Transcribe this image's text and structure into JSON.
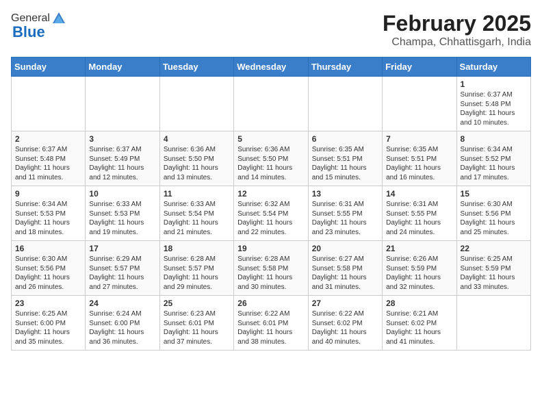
{
  "header": {
    "logo_general": "General",
    "logo_blue": "Blue",
    "month_year": "February 2025",
    "location": "Champa, Chhattisgarh, India"
  },
  "days_of_week": [
    "Sunday",
    "Monday",
    "Tuesday",
    "Wednesday",
    "Thursday",
    "Friday",
    "Saturday"
  ],
  "weeks": [
    [
      {
        "day": "",
        "info": ""
      },
      {
        "day": "",
        "info": ""
      },
      {
        "day": "",
        "info": ""
      },
      {
        "day": "",
        "info": ""
      },
      {
        "day": "",
        "info": ""
      },
      {
        "day": "",
        "info": ""
      },
      {
        "day": "1",
        "info": "Sunrise: 6:37 AM\nSunset: 5:48 PM\nDaylight: 11 hours\nand 10 minutes."
      }
    ],
    [
      {
        "day": "2",
        "info": "Sunrise: 6:37 AM\nSunset: 5:48 PM\nDaylight: 11 hours\nand 11 minutes."
      },
      {
        "day": "3",
        "info": "Sunrise: 6:37 AM\nSunset: 5:49 PM\nDaylight: 11 hours\nand 12 minutes."
      },
      {
        "day": "4",
        "info": "Sunrise: 6:36 AM\nSunset: 5:50 PM\nDaylight: 11 hours\nand 13 minutes."
      },
      {
        "day": "5",
        "info": "Sunrise: 6:36 AM\nSunset: 5:50 PM\nDaylight: 11 hours\nand 14 minutes."
      },
      {
        "day": "6",
        "info": "Sunrise: 6:35 AM\nSunset: 5:51 PM\nDaylight: 11 hours\nand 15 minutes."
      },
      {
        "day": "7",
        "info": "Sunrise: 6:35 AM\nSunset: 5:51 PM\nDaylight: 11 hours\nand 16 minutes."
      },
      {
        "day": "8",
        "info": "Sunrise: 6:34 AM\nSunset: 5:52 PM\nDaylight: 11 hours\nand 17 minutes."
      }
    ],
    [
      {
        "day": "9",
        "info": "Sunrise: 6:34 AM\nSunset: 5:53 PM\nDaylight: 11 hours\nand 18 minutes."
      },
      {
        "day": "10",
        "info": "Sunrise: 6:33 AM\nSunset: 5:53 PM\nDaylight: 11 hours\nand 19 minutes."
      },
      {
        "day": "11",
        "info": "Sunrise: 6:33 AM\nSunset: 5:54 PM\nDaylight: 11 hours\nand 21 minutes."
      },
      {
        "day": "12",
        "info": "Sunrise: 6:32 AM\nSunset: 5:54 PM\nDaylight: 11 hours\nand 22 minutes."
      },
      {
        "day": "13",
        "info": "Sunrise: 6:31 AM\nSunset: 5:55 PM\nDaylight: 11 hours\nand 23 minutes."
      },
      {
        "day": "14",
        "info": "Sunrise: 6:31 AM\nSunset: 5:55 PM\nDaylight: 11 hours\nand 24 minutes."
      },
      {
        "day": "15",
        "info": "Sunrise: 6:30 AM\nSunset: 5:56 PM\nDaylight: 11 hours\nand 25 minutes."
      }
    ],
    [
      {
        "day": "16",
        "info": "Sunrise: 6:30 AM\nSunset: 5:56 PM\nDaylight: 11 hours\nand 26 minutes."
      },
      {
        "day": "17",
        "info": "Sunrise: 6:29 AM\nSunset: 5:57 PM\nDaylight: 11 hours\nand 27 minutes."
      },
      {
        "day": "18",
        "info": "Sunrise: 6:28 AM\nSunset: 5:57 PM\nDaylight: 11 hours\nand 29 minutes."
      },
      {
        "day": "19",
        "info": "Sunrise: 6:28 AM\nSunset: 5:58 PM\nDaylight: 11 hours\nand 30 minutes."
      },
      {
        "day": "20",
        "info": "Sunrise: 6:27 AM\nSunset: 5:58 PM\nDaylight: 11 hours\nand 31 minutes."
      },
      {
        "day": "21",
        "info": "Sunrise: 6:26 AM\nSunset: 5:59 PM\nDaylight: 11 hours\nand 32 minutes."
      },
      {
        "day": "22",
        "info": "Sunrise: 6:25 AM\nSunset: 5:59 PM\nDaylight: 11 hours\nand 33 minutes."
      }
    ],
    [
      {
        "day": "23",
        "info": "Sunrise: 6:25 AM\nSunset: 6:00 PM\nDaylight: 11 hours\nand 35 minutes."
      },
      {
        "day": "24",
        "info": "Sunrise: 6:24 AM\nSunset: 6:00 PM\nDaylight: 11 hours\nand 36 minutes."
      },
      {
        "day": "25",
        "info": "Sunrise: 6:23 AM\nSunset: 6:01 PM\nDaylight: 11 hours\nand 37 minutes."
      },
      {
        "day": "26",
        "info": "Sunrise: 6:22 AM\nSunset: 6:01 PM\nDaylight: 11 hours\nand 38 minutes."
      },
      {
        "day": "27",
        "info": "Sunrise: 6:22 AM\nSunset: 6:02 PM\nDaylight: 11 hours\nand 40 minutes."
      },
      {
        "day": "28",
        "info": "Sunrise: 6:21 AM\nSunset: 6:02 PM\nDaylight: 11 hours\nand 41 minutes."
      },
      {
        "day": "",
        "info": ""
      }
    ]
  ]
}
